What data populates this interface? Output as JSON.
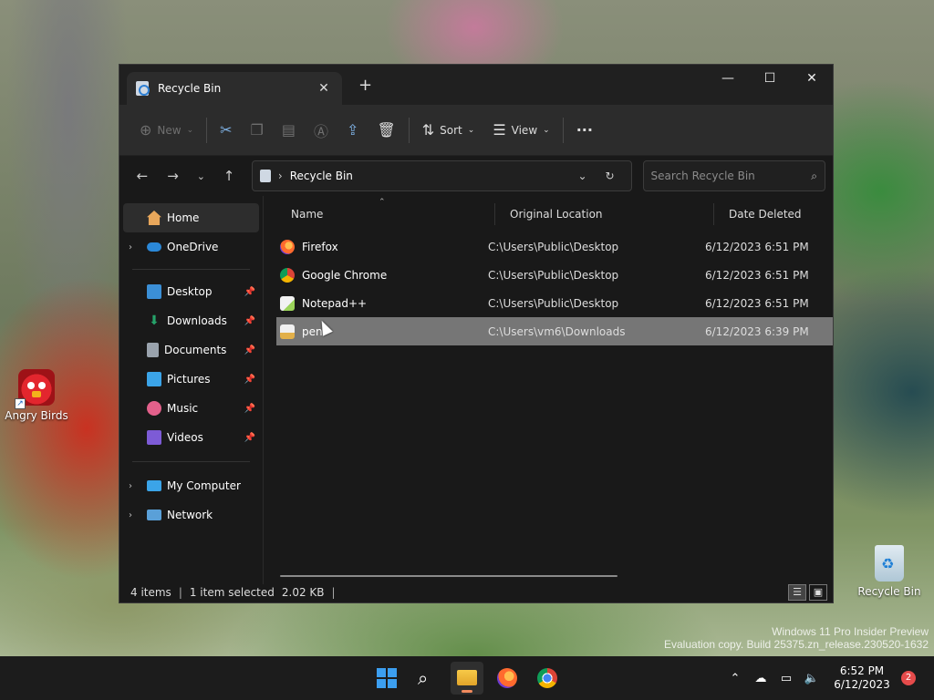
{
  "desktop": {
    "icons": [
      {
        "label": "Angry Birds"
      },
      {
        "label": "Recycle Bin"
      }
    ],
    "watermark": {
      "line1": "Windows 11 Pro Insider Preview",
      "line2": "Evaluation copy. Build 25375.zn_release.230520-1632"
    }
  },
  "window": {
    "tab_title": "Recycle Bin",
    "tab_close": "✕",
    "new_tab": "+",
    "controls": {
      "minimize": "—",
      "maximize": "☐",
      "close": "✕"
    },
    "toolbar": {
      "new_label": "New",
      "sort_label": "Sort",
      "view_label": "View",
      "more": "···"
    },
    "address": {
      "crumb": "Recycle Bin"
    },
    "search": {
      "placeholder": "Search Recycle Bin"
    },
    "sidebar": {
      "home": "Home",
      "onedrive": "OneDrive",
      "pinned": [
        {
          "label": "Desktop",
          "color": "#3b8fd6"
        },
        {
          "label": "Downloads",
          "color": "#26a269"
        },
        {
          "label": "Documents",
          "color": "#9aa3ad"
        },
        {
          "label": "Pictures",
          "color": "#3ba4e8"
        },
        {
          "label": "Music",
          "color": "#e3608b"
        },
        {
          "label": "Videos",
          "color": "#7d5bd6"
        }
      ],
      "mycomputer": "My Computer",
      "network": "Network"
    },
    "columns": {
      "name": "Name",
      "location": "Original Location",
      "date": "Date Deleted"
    },
    "files": [
      {
        "name": "Firefox",
        "location": "C:\\Users\\Public\\Desktop",
        "date": "6/12/2023 6:51 PM",
        "icon": "firefox-icon"
      },
      {
        "name": "Google Chrome",
        "location": "C:\\Users\\Public\\Desktop",
        "date": "6/12/2023 6:51 PM",
        "icon": "chrome-icon"
      },
      {
        "name": "Notepad++",
        "location": "C:\\Users\\Public\\Desktop",
        "date": "6/12/2023 6:51 PM",
        "icon": "notepadpp-icon"
      },
      {
        "name": "peni",
        "location": "C:\\Users\\vm6\\Downloads",
        "date": "6/12/2023 6:39 PM",
        "icon": "file-icon"
      }
    ],
    "status": {
      "items": "4 items",
      "selected": "1 item selected",
      "size": "2.02 KB"
    }
  },
  "taskbar": {
    "clock_time": "6:52 PM",
    "clock_date": "6/12/2023",
    "notification_count": "2"
  },
  "colors": {
    "accent": "#3c9ff0",
    "selection": "#767676"
  }
}
